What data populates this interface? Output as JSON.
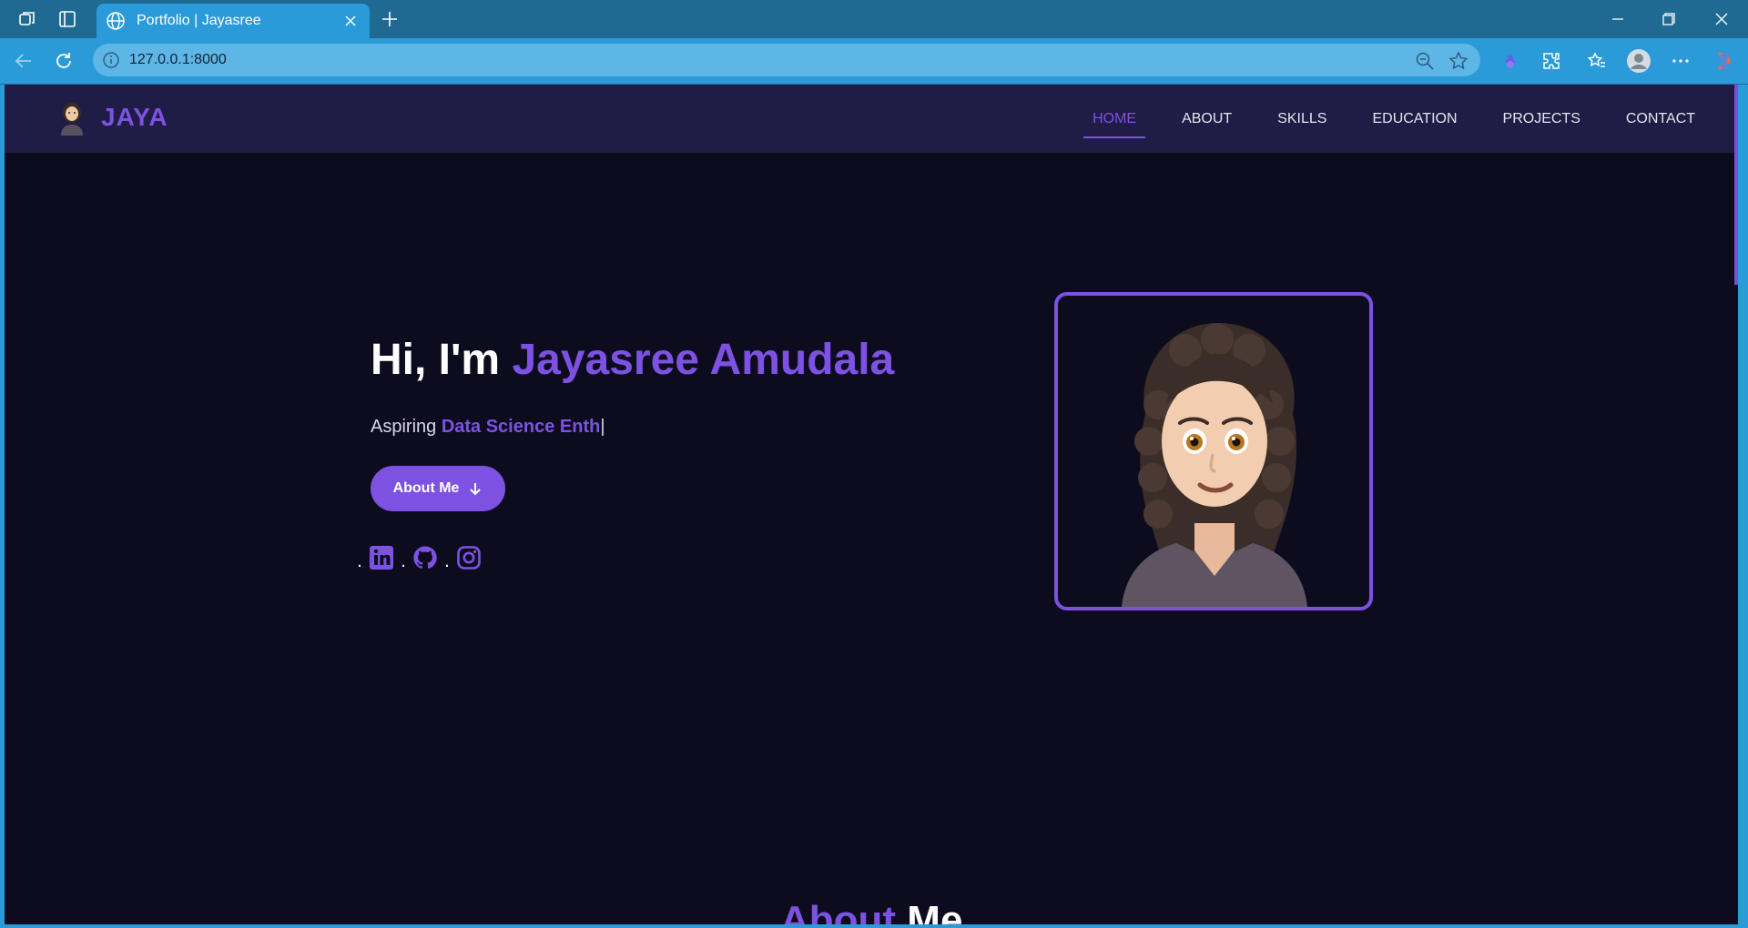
{
  "browser": {
    "tab_title": "Portfolio | Jayasree",
    "url": "127.0.0.1:8000"
  },
  "nav": {
    "brand": "JAYA",
    "links": [
      "HOME",
      "ABOUT",
      "SKILLS",
      "EDUCATION",
      "PROJECTS",
      "CONTACT"
    ],
    "active": "HOME"
  },
  "hero": {
    "greeting": "Hi, I'm ",
    "name": "Jayasree Amudala",
    "sub_prefix": "Aspiring ",
    "sub_typed": "Data Science Enth",
    "cursor": "|",
    "button_label": "About Me",
    "social_separator": ".",
    "socials": [
      "linkedin-icon",
      "github-icon",
      "instagram-icon"
    ]
  },
  "about_heading": {
    "accent": "About",
    "rest": " Me"
  },
  "colors": {
    "accent": "#7d52e2",
    "page_bg": "#0d0c1f",
    "nav_bg": "#1f1c45",
    "chrome": "#2a9bd8"
  }
}
